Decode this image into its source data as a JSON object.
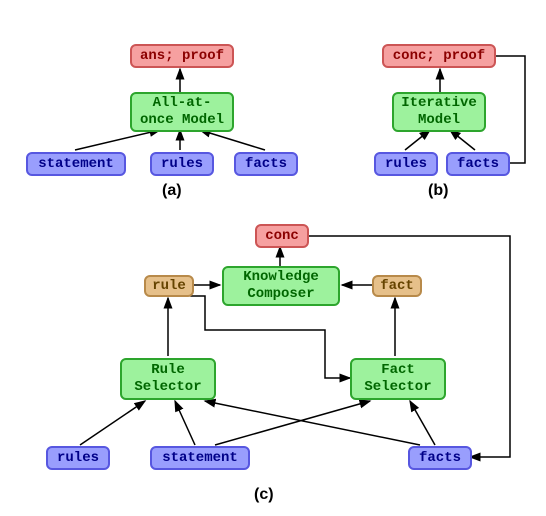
{
  "a": {
    "output": "ans; proof",
    "model": "All-at-once Model",
    "inputs": {
      "stmt": "statement",
      "rules": "rules",
      "facts": "facts"
    },
    "label": "(a)"
  },
  "b": {
    "output": "conc; proof",
    "model": "Iterative Model",
    "inputs": {
      "rules": "rules",
      "facts": "facts"
    },
    "label": "(b)"
  },
  "c": {
    "output": "conc",
    "composer": "Knowledge Composer",
    "rule_int": "rule",
    "fact_int": "fact",
    "rule_sel": "Rule Selector",
    "fact_sel": "Fact Selector",
    "inputs": {
      "rules": "rules",
      "stmt": "statement",
      "facts": "facts"
    },
    "label": "(c)"
  }
}
